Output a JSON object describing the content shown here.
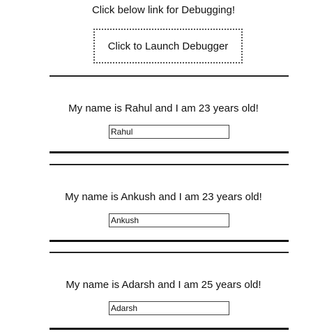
{
  "header": {
    "text": "Click below link for Debugging!"
  },
  "launch_button": {
    "label": "Click to Launch Debugger"
  },
  "people": [
    {
      "message": "My name is Rahul and I am 23 years old!",
      "input_value": "Rahul"
    },
    {
      "message": "My name is Ankush and I am 23 years old!",
      "input_value": "Ankush"
    },
    {
      "message": "My name is Adarsh and I am 25 years old!",
      "input_value": "Adarsh"
    }
  ]
}
